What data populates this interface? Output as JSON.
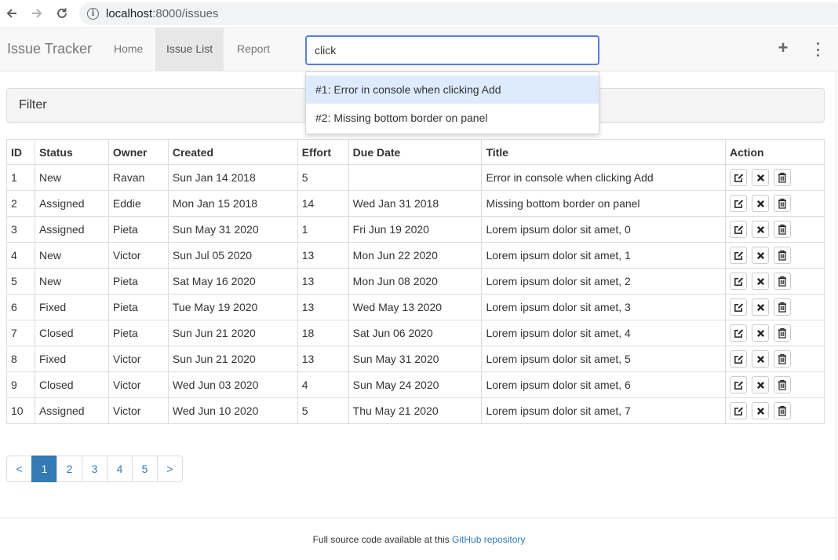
{
  "browser": {
    "url_host": "localhost",
    "url_rest": ":8000/issues"
  },
  "navbar": {
    "brand": "Issue Tracker",
    "links": [
      "Home",
      "Issue List",
      "Report"
    ],
    "active_link": "Issue List",
    "search_value": "click",
    "icons": [
      "plus-icon",
      "kebab-menu-icon"
    ]
  },
  "search_results": [
    "#1: Error in console when clicking Add",
    "#2: Missing bottom border on panel"
  ],
  "filter": {
    "title": "Filter"
  },
  "table": {
    "headers": [
      "ID",
      "Status",
      "Owner",
      "Created",
      "Effort",
      "Due Date",
      "Title",
      "Action"
    ],
    "rows": [
      [
        "1",
        "New",
        "Ravan",
        "Sun Jan 14 2018",
        "5",
        "",
        "Error in console when clicking Add"
      ],
      [
        "2",
        "Assigned",
        "Eddie",
        "Mon Jan 15 2018",
        "14",
        "Wed Jan 31 2018",
        "Missing bottom border on panel"
      ],
      [
        "3",
        "Assigned",
        "Pieta",
        "Sun May 31 2020",
        "1",
        "Fri Jun 19 2020",
        "Lorem ipsum dolor sit amet, 0"
      ],
      [
        "4",
        "New",
        "Victor",
        "Sun Jul 05 2020",
        "13",
        "Mon Jun 22 2020",
        "Lorem ipsum dolor sit amet, 1"
      ],
      [
        "5",
        "New",
        "Pieta",
        "Sat May 16 2020",
        "13",
        "Mon Jun 08 2020",
        "Lorem ipsum dolor sit amet, 2"
      ],
      [
        "6",
        "Fixed",
        "Pieta",
        "Tue May 19 2020",
        "13",
        "Wed May 13 2020",
        "Lorem ipsum dolor sit amet, 3"
      ],
      [
        "7",
        "Closed",
        "Pieta",
        "Sun Jun 21 2020",
        "18",
        "Sat Jun 06 2020",
        "Lorem ipsum dolor sit amet, 4"
      ],
      [
        "8",
        "Fixed",
        "Victor",
        "Sun Jun 21 2020",
        "13",
        "Sun May 31 2020",
        "Lorem ipsum dolor sit amet, 5"
      ],
      [
        "9",
        "Closed",
        "Victor",
        "Wed Jun 03 2020",
        "4",
        "Sun May 24 2020",
        "Lorem ipsum dolor sit amet, 6"
      ],
      [
        "10",
        "Assigned",
        "Victor",
        "Wed Jun 10 2020",
        "5",
        "Thu May 21 2020",
        "Lorem ipsum dolor sit amet, 7"
      ]
    ],
    "action_icons": [
      "edit-icon",
      "close-icon",
      "trash-icon"
    ]
  },
  "pagination": {
    "prev": "<",
    "pages": [
      "1",
      "2",
      "3",
      "4",
      "5"
    ],
    "active_page": "1",
    "next": ">"
  },
  "footer": {
    "text": "Full source code available at this ",
    "link": "GitHub repository"
  },
  "colors": {
    "accent": "#337ab7",
    "search_border": "#5b7fd6",
    "highlight": "#deebff"
  }
}
